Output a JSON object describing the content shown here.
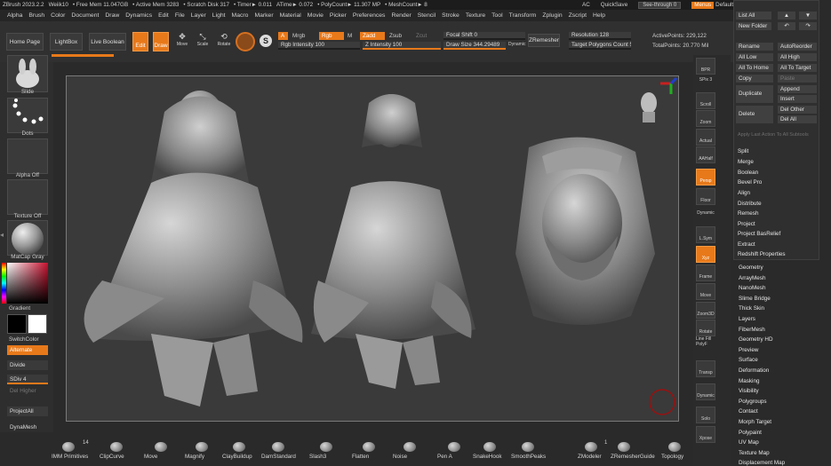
{
  "titlebar": {
    "app": "ZBrush 2023.2.2",
    "user": "Weiik10",
    "free_mem": "• Free Mem 11.047GB",
    "active_mem": "• Active Mem 3283",
    "scratch": "• Scratch Disk 317",
    "timer": "• Timer► 0.011",
    "atime": "ATime► 0.072",
    "polycount": "• PolyCount► 11.307 MP",
    "meshcount": "• MeshCount► 8",
    "ac": "AC",
    "quicksave": "QuickSave",
    "see_through": "See-through  0",
    "menus": "Menus",
    "script": "DefaultZScript"
  },
  "menubar": [
    "Alpha",
    "Brush",
    "Color",
    "Document",
    "Draw",
    "Dynamics",
    "Edit",
    "File",
    "Layer",
    "Light",
    "Macro",
    "Marker",
    "Material",
    "Movie",
    "Picker",
    "Preferences",
    "Render",
    "Stencil",
    "Stroke",
    "Texture",
    "Tool",
    "Transform",
    "Zplugin",
    "Zscript",
    "Help"
  ],
  "toolbar": {
    "home": "Home Page",
    "lightbox": "LightBox",
    "live_boolean": "Live Boolean",
    "edit": "Edit",
    "draw": "Draw",
    "move": "Move",
    "scale": "Scale",
    "rotate": "Rotate",
    "a_label": "A",
    "mrgb": "Mrgb",
    "rgb": "Rgb",
    "m": "M",
    "zadd": "Zadd",
    "zsub": "Zsub",
    "zcut": "Zcut",
    "rgb_intensity": "Rgb Intensity 100",
    "z_intensity": "Z Intensity 100",
    "focal_shift": "Focal Shift 0",
    "draw_size": "Draw Size 344.29489",
    "dynamic": "Dynamic",
    "zremesher": "ZRemesher",
    "resolution": "Resolution 128",
    "target_poly": "Target Polygons Count 5",
    "active_points": "ActivePoints: 229,122",
    "total_points": "TotalPoints: 20.770 Mil"
  },
  "leftshelf": {
    "slide": "Slide",
    "dots": "Dots",
    "alpha_off": "Alpha Off",
    "texture_off": "Texture Off",
    "matcap": "MatCap Gray",
    "gradient": "Gradient",
    "switchcolor": "SwitchColor",
    "alternate": "Alternate",
    "divide": "Divide",
    "sdiv": "SDiv 4",
    "del_higher": "Del Higher",
    "project_all": "ProjectAll",
    "dynamesh": "DynaMesh"
  },
  "rightshelf": [
    {
      "name": "bpr",
      "label": "BPR"
    },
    {
      "name": "spix",
      "label": "SPix 3"
    },
    {
      "name": "scroll",
      "label": "Scroll"
    },
    {
      "name": "zoom",
      "label": "Zoom"
    },
    {
      "name": "actual",
      "label": "Actual"
    },
    {
      "name": "aahalf",
      "label": "AAHalf"
    },
    {
      "name": "persp",
      "label": "Persp"
    },
    {
      "name": "floor",
      "label": "Floor"
    },
    {
      "name": "dynamic",
      "label": "Dynamic"
    },
    {
      "name": "lsym",
      "label": "L.Sym"
    },
    {
      "name": "xyz",
      "label": "Xyz"
    },
    {
      "name": "frame",
      "label": "Frame"
    },
    {
      "name": "move",
      "label": "Move"
    },
    {
      "name": "zoom3d",
      "label": "Zoom3D"
    },
    {
      "name": "rotate",
      "label": "Rotate"
    },
    {
      "name": "linefill",
      "label": "Line Fill PolyF"
    },
    {
      "name": "transp",
      "label": "Transp"
    },
    {
      "name": "dynamic2",
      "label": "Dynamic"
    },
    {
      "name": "solo",
      "label": "Solo"
    },
    {
      "name": "xpose",
      "label": "Xpose"
    }
  ],
  "rpanel": {
    "list_all": "List All",
    "new_folder": "New Folder",
    "rename": "Rename",
    "autoreorder": "AutoReorder",
    "all_low": "All Low",
    "all_high": "All High",
    "all_to_home": "All To Home",
    "all_to_target": "All To Target",
    "copy": "Copy",
    "paste": "Paste",
    "duplicate": "Duplicate",
    "append": "Append",
    "insert": "Insert",
    "delete": "Delete",
    "del_other": "Del Other",
    "del_all": "Del All",
    "apply_last": "Apply Last Action To All Subtools",
    "split": "Split",
    "merge": "Merge",
    "boolean": "Boolean",
    "bevel_pro": "Bevel Pro",
    "align": "Align",
    "distribute": "Distribute",
    "remesh": "Remesh",
    "project": "Project",
    "project_basrelief": "Project BasRelief",
    "extract": "Extract",
    "redshift": "Redshift Properties",
    "sections": [
      "Geometry",
      "ArrayMesh",
      "NanoMesh",
      "Slime Bridge",
      "Thick Skin",
      "Layers",
      "FiberMesh",
      "Geometry HD",
      "Preview",
      "Surface",
      "Deformation",
      "Masking",
      "Visibility",
      "Polygroups",
      "Contact",
      "Morph Target",
      "Polypaint",
      "UV Map",
      "Texture Map",
      "Displacement Map"
    ]
  },
  "bottom": {
    "count": "14",
    "brushes": [
      "IMM Primitives",
      "ClipCurve",
      "Move",
      "Magnify",
      "ClayBuildup",
      "DamStandard",
      "Slash3",
      "Flatten",
      "Noise",
      "Pen A",
      "SnakeHook",
      "SmoothPeaks"
    ],
    "zmodeler_count": "1",
    "right_brushes": [
      "ZModeler",
      "ZRemesherGuide",
      "Topology"
    ]
  },
  "colors": {
    "accent": "#e8791a",
    "panel": "#2a2a2a",
    "button": "#3a3a3a"
  }
}
